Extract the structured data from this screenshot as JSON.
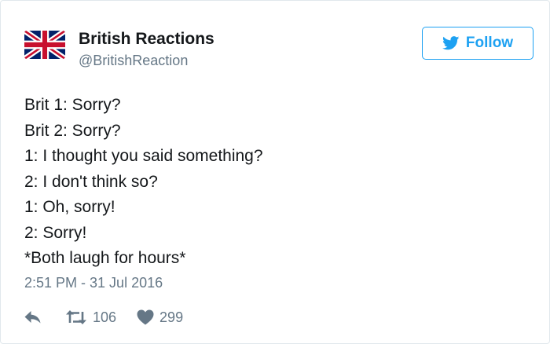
{
  "tweet": {
    "author": {
      "name": "British Reactions",
      "handle": "@BritishReaction",
      "avatar_icon": "union-jack-flag-icon"
    },
    "follow_label": "Follow",
    "lines": [
      "Brit 1: Sorry?",
      "Brit 2: Sorry?",
      "1: I thought you said something?",
      "2: I don't think so?",
      "1: Oh, sorry!",
      "2: Sorry!",
      "*Both laugh for hours*"
    ],
    "timestamp": "2:51 PM - 31 Jul 2016",
    "actions": {
      "reply_icon": "reply-icon",
      "retweet_icon": "retweet-icon",
      "retweets": "106",
      "like_icon": "heart-icon",
      "likes": "299"
    }
  },
  "colors": {
    "accent": "#1da1f2",
    "muted": "#657786",
    "text": "#14171a",
    "border": "#e1e8ed"
  }
}
